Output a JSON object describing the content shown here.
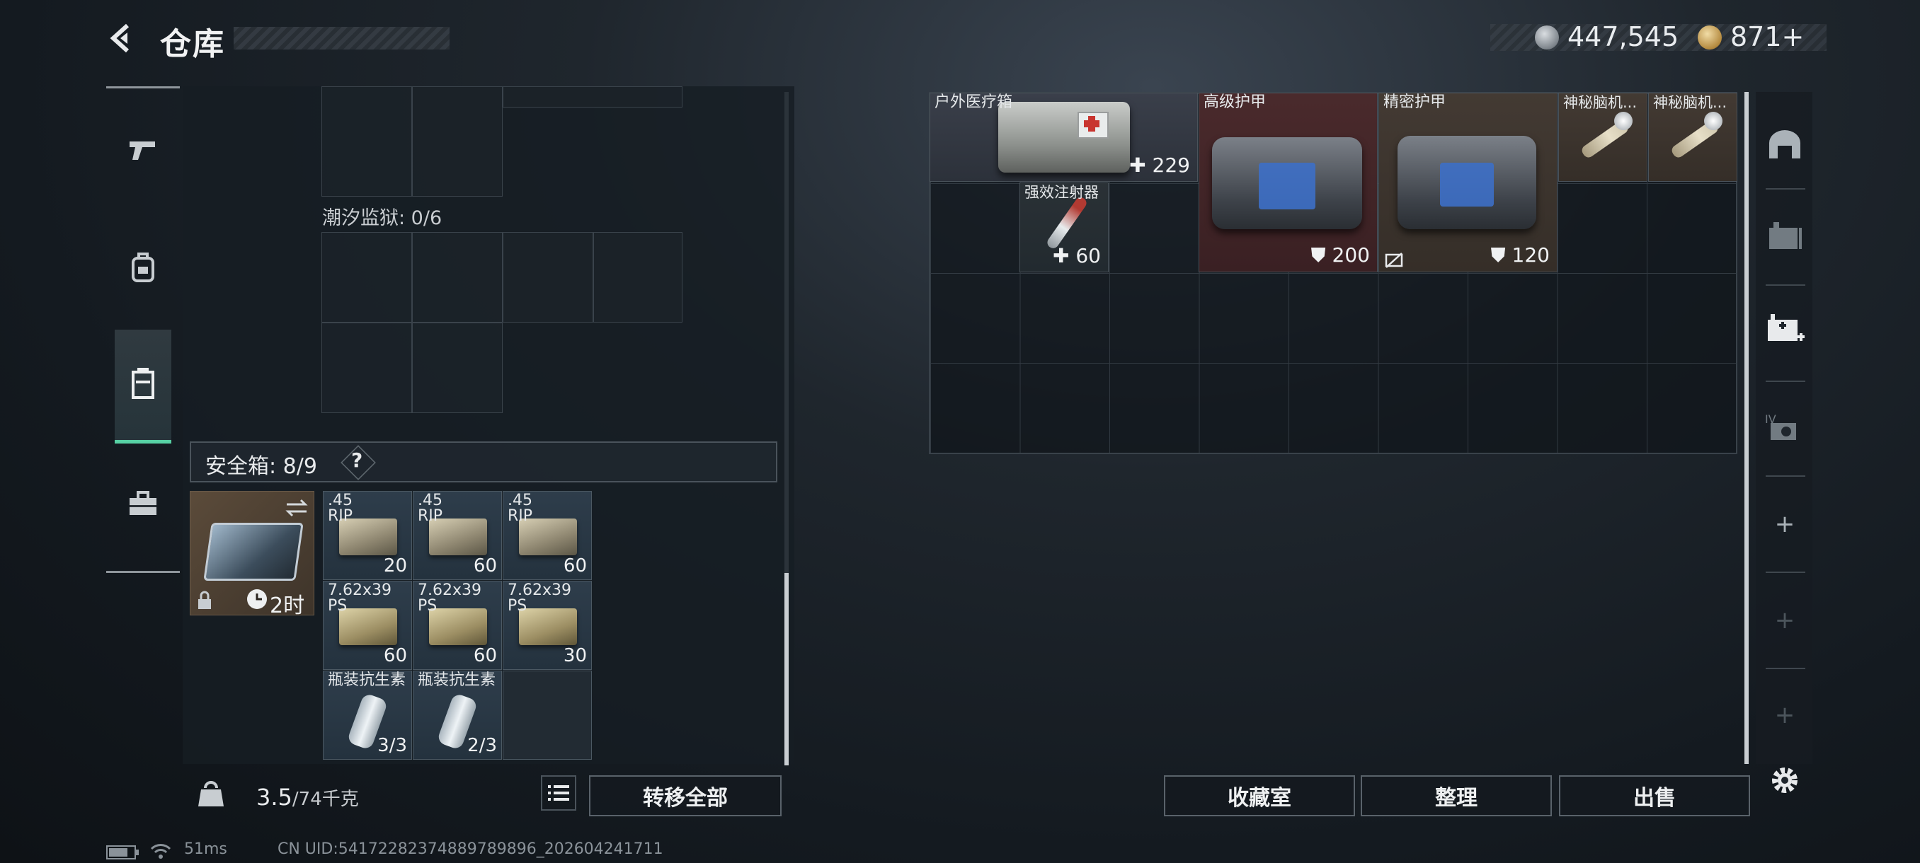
{
  "header": {
    "title": "仓库",
    "currency1": "447,545",
    "currency2": "871+"
  },
  "left": {
    "section_label": "潮汐监狱: 0/6",
    "safe_label": "安全箱: 8/9",
    "help": "?",
    "safebox_timer": "2时",
    "items": [
      {
        "name": ".45\nRIP",
        "count": "20"
      },
      {
        "name": ".45\nRIP",
        "count": "60"
      },
      {
        "name": ".45\nRIP",
        "count": "60"
      },
      {
        "name": "7.62x39\nPS",
        "count": "60"
      },
      {
        "name": "7.62x39\nPS",
        "count": "60"
      },
      {
        "name": "7.62x39\nPS",
        "count": "30"
      },
      {
        "name": "瓶装抗生素",
        "count": "3/3"
      },
      {
        "name": "瓶装抗生素",
        "count": "2/3"
      }
    ],
    "weight_value": "3.5",
    "weight_unit": "/74千克",
    "transfer_all": "转移全部"
  },
  "stash": {
    "medkit": {
      "name": "户外医疗箱",
      "stat": "229"
    },
    "armor_high": {
      "name": "高级护甲",
      "stat": "200"
    },
    "armor_precise": {
      "name": "精密护甲",
      "stat": "120"
    },
    "brain1": {
      "name": "神秘脑机..."
    },
    "brain2": {
      "name": "神秘脑机..."
    },
    "injector": {
      "name": "强效注射器",
      "stat": "60"
    }
  },
  "actions": {
    "collection": "收藏室",
    "sort": "整理",
    "sell": "出售"
  },
  "footer": {
    "ping": "51ms",
    "uid": "CN UID:54172282374889789896_202604241711"
  },
  "colors": {
    "accent": "#57d1a4",
    "armor_red": "#4a2a2c",
    "ammo_blue": "#2e3d4b"
  }
}
